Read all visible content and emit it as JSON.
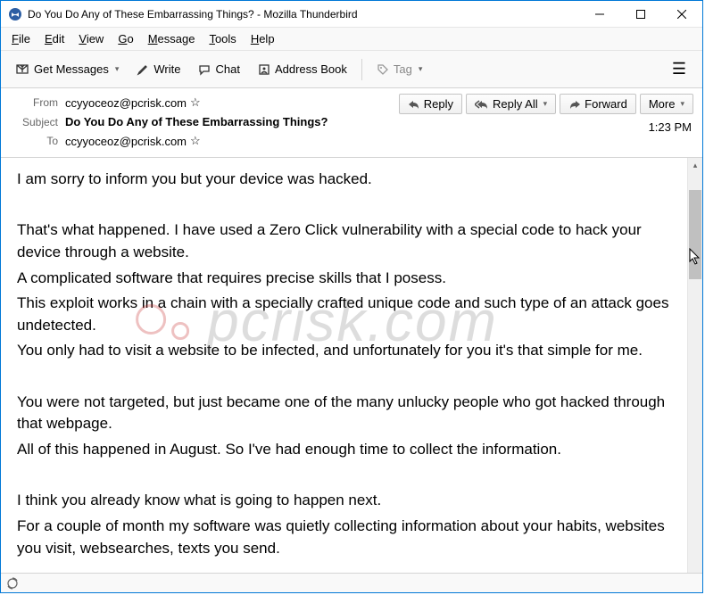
{
  "window": {
    "title": "Do You Do Any of These Embarrassing Things? - Mozilla Thunderbird"
  },
  "menus": {
    "file": "File",
    "edit": "Edit",
    "view": "View",
    "go": "Go",
    "message": "Message",
    "tools": "Tools",
    "help": "Help"
  },
  "toolbar": {
    "get_messages": "Get Messages",
    "write": "Write",
    "chat": "Chat",
    "address_book": "Address Book",
    "tag": "Tag"
  },
  "headers": {
    "from_label": "From",
    "from_value": "ccyyoceoz@pcrisk.com",
    "subject_label": "Subject",
    "subject_value": "Do You Do Any of These Embarrassing Things?",
    "to_label": "To",
    "to_value": "ccyyoceoz@pcrisk.com",
    "time": "1:23 PM"
  },
  "actions": {
    "reply": "Reply",
    "reply_all": "Reply All",
    "forward": "Forward",
    "more": "More"
  },
  "body": {
    "p1": "I am sorry to inform you but your device was hacked.",
    "p2": "That's what happened. I have used a Zero Click vulnerability with a special code to hack your device through a website.",
    "p3": "A complicated software that requires precise skills that I posess.",
    "p4": "This exploit works in a chain with a specially crafted unique code and such type of an attack goes undetected.",
    "p5": "You only had to visit a website to be infected, and unfortunately for you it's that simple for me.",
    "p6": "You were not targeted, but just became one of the many unlucky people who got hacked through that webpage.",
    "p7": "All of this happened in August. So I've had enough time to collect the information.",
    "p8": "I think you already know what is going to happen next.",
    "p9": "For a couple of month my software was quietly collecting information about your habits, websites you visit, websearches, texts you send."
  },
  "watermark": "pcrisk.com"
}
